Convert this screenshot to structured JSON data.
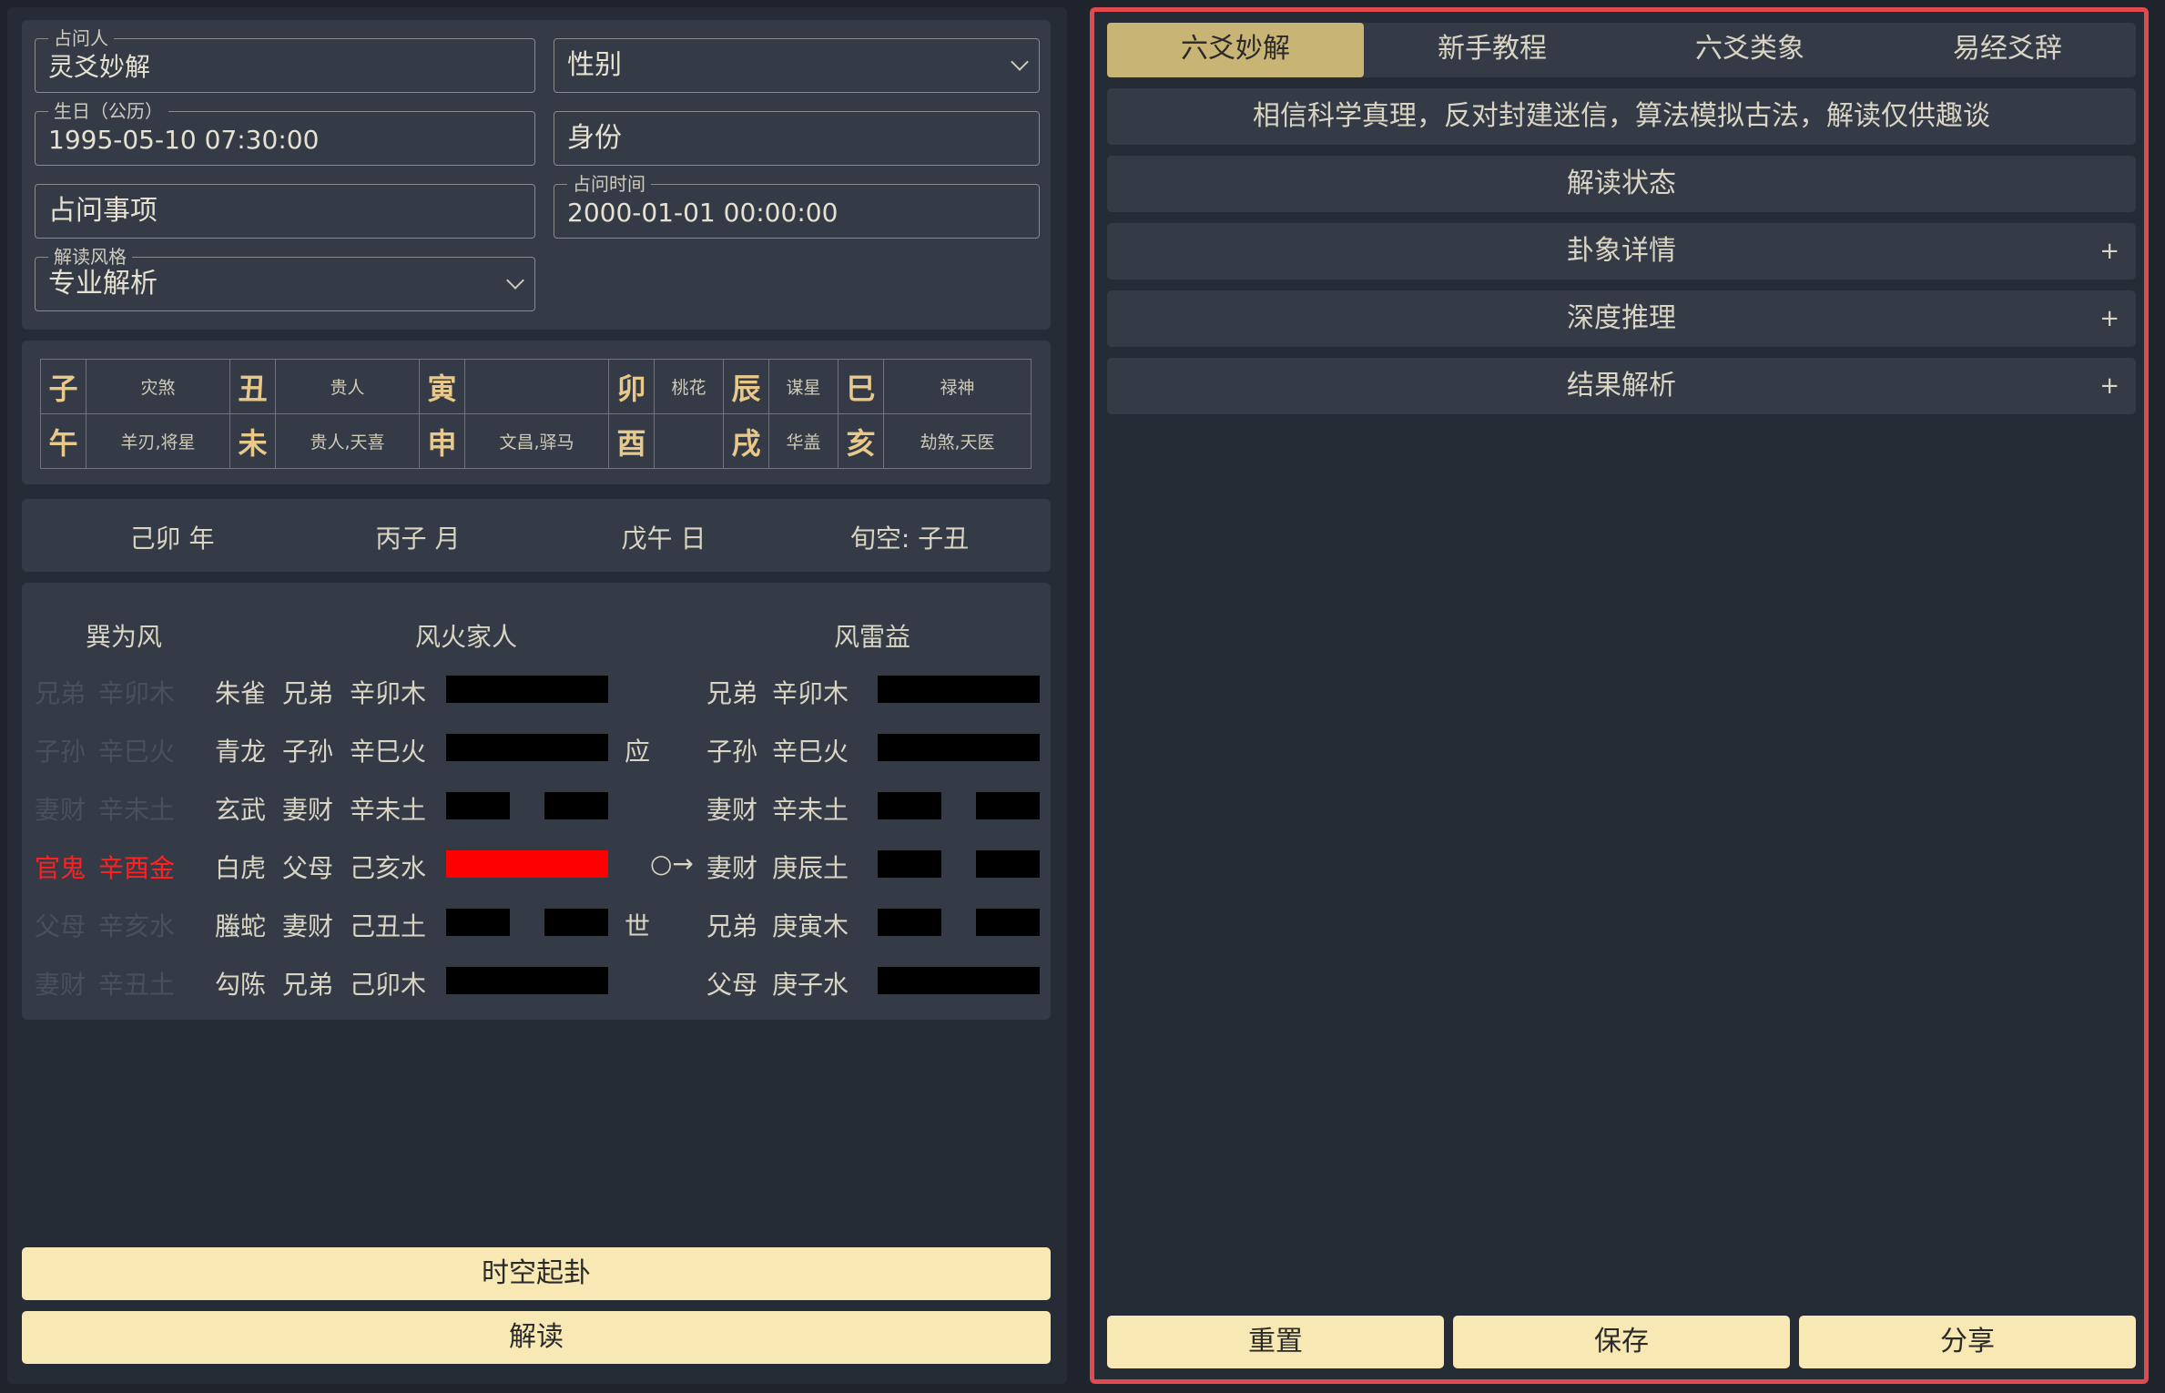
{
  "form": {
    "asker_label": "占问人",
    "asker_value": "灵爻妙解",
    "gender_value": "性别",
    "birth_label": "生日（公历）",
    "birth_value": "1995-05-10 07:30:00",
    "identity_value": "身份",
    "matter_value": "占问事项",
    "time_label": "占问时间",
    "time_value": "2000-01-01 00:00:00",
    "style_label": "解读风格",
    "style_value": "专业解析"
  },
  "shensha": {
    "row1": [
      {
        "zhi": "子",
        "sha": "灾煞"
      },
      {
        "zhi": "丑",
        "sha": "贵人"
      },
      {
        "zhi": "寅",
        "sha": ""
      },
      {
        "zhi": "卯",
        "sha": "桃花"
      },
      {
        "zhi": "辰",
        "sha": "谋星"
      },
      {
        "zhi": "巳",
        "sha": "禄神"
      }
    ],
    "row2": [
      {
        "zhi": "午",
        "sha": "羊刃,将星"
      },
      {
        "zhi": "未",
        "sha": "贵人,天喜"
      },
      {
        "zhi": "申",
        "sha": "文昌,驿马"
      },
      {
        "zhi": "酉",
        "sha": ""
      },
      {
        "zhi": "戌",
        "sha": "华盖"
      },
      {
        "zhi": "亥",
        "sha": "劫煞,天医"
      }
    ]
  },
  "ganzhi": {
    "year": "己卯 年",
    "month": "丙子 月",
    "day": "戊午 日",
    "xunkong": "旬空: 子丑"
  },
  "gua": {
    "fu_title": "巽为风",
    "main_title": "风火家人",
    "bian_title": "风雷益",
    "yaos": [
      {
        "fu_rel": "兄弟",
        "fu_gz": "辛卯木",
        "fu_state": "faded",
        "shen": "朱雀",
        "rel": "兄弟",
        "gz": "辛卯木",
        "yang": true,
        "moving": false,
        "mark": "",
        "bian_rel": "兄弟",
        "bian_gz": "辛卯木",
        "bian_yang": true
      },
      {
        "fu_rel": "子孙",
        "fu_gz": "辛巳火",
        "fu_state": "faded",
        "shen": "青龙",
        "rel": "子孙",
        "gz": "辛巳火",
        "yang": true,
        "moving": false,
        "mark": "应",
        "bian_rel": "子孙",
        "bian_gz": "辛巳火",
        "bian_yang": true
      },
      {
        "fu_rel": "妻财",
        "fu_gz": "辛未土",
        "fu_state": "faded",
        "shen": "玄武",
        "rel": "妻财",
        "gz": "辛未土",
        "yang": false,
        "moving": false,
        "mark": "",
        "bian_rel": "妻财",
        "bian_gz": "辛未土",
        "bian_yang": false
      },
      {
        "fu_rel": "官鬼",
        "fu_gz": "辛酉金",
        "fu_state": "red",
        "shen": "白虎",
        "rel": "父母",
        "gz": "己亥水",
        "yang": true,
        "moving": true,
        "mark": "○→",
        "bian_rel": "妻财",
        "bian_gz": "庚辰土",
        "bian_yang": false
      },
      {
        "fu_rel": "父母",
        "fu_gz": "辛亥水",
        "fu_state": "faded",
        "shen": "螣蛇",
        "rel": "妻财",
        "gz": "己丑土",
        "yang": false,
        "moving": false,
        "mark": "世",
        "bian_rel": "兄弟",
        "bian_gz": "庚寅木",
        "bian_yang": false
      },
      {
        "fu_rel": "妻财",
        "fu_gz": "辛丑土",
        "fu_state": "faded",
        "shen": "勾陈",
        "rel": "兄弟",
        "gz": "己卯木",
        "yang": true,
        "moving": false,
        "mark": "",
        "bian_rel": "父母",
        "bian_gz": "庚子水",
        "bian_yang": true
      }
    ]
  },
  "buttons": {
    "qigua": "时空起卦",
    "jiedu": "解读",
    "reset": "重置",
    "save": "保存",
    "share": "分享"
  },
  "tabs": [
    "六爻妙解",
    "新手教程",
    "六爻类象",
    "易经爻辞"
  ],
  "right": {
    "disclaimer": "相信科学真理，反对封建迷信，算法模拟古法，解读仅供趣谈",
    "sections": [
      {
        "label": "解读状态",
        "plus": ""
      },
      {
        "label": "卦象详情",
        "plus": "+"
      },
      {
        "label": "深度推理",
        "plus": "+"
      },
      {
        "label": "结果解析",
        "plus": "+"
      }
    ]
  },
  "colors": {
    "accent_gold": "#c8b475",
    "cream_button": "#f7e8b4",
    "moving_line": "#ff0000",
    "focus_border": "#e14a4f"
  }
}
